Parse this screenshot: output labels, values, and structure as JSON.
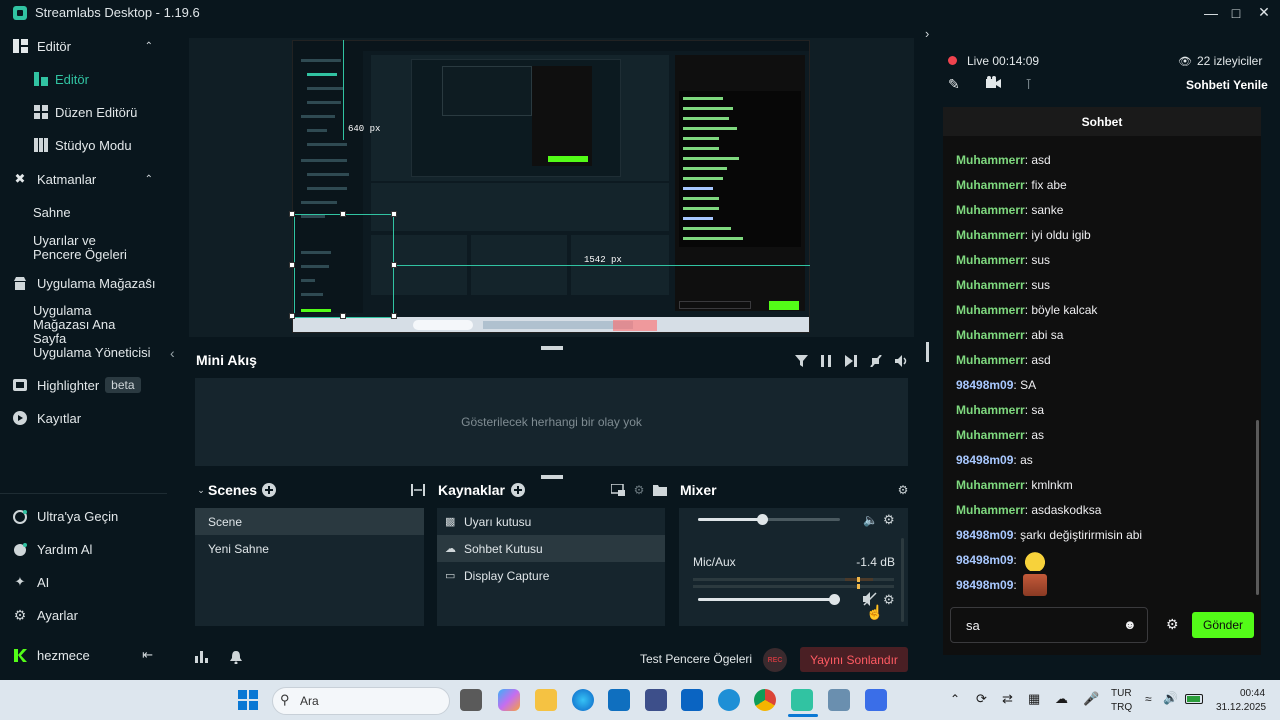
{
  "app": {
    "title": "Streamlabs Desktop - 1.19.6"
  },
  "sidebar": {
    "items": [
      {
        "label": "Editör",
        "icon": "layout-icon"
      },
      {
        "label": "Editör",
        "icon": "editor-icon"
      },
      {
        "label": "Düzen Editörü",
        "icon": "grid-icon"
      },
      {
        "label": "Stüdyo Modu",
        "icon": "studio-icon"
      },
      {
        "label": "Katmanlar",
        "icon": "tools-icon"
      },
      {
        "label": "Sahne"
      },
      {
        "label": "Uyarılar ve Pencere Ögeleri"
      },
      {
        "label": "Uygulama Mağazası",
        "icon": "store-icon"
      },
      {
        "label": "Uygulama Mağazası Ana Sayfa"
      },
      {
        "label": "Uygulama Yöneticisi"
      },
      {
        "label": "Highlighter",
        "icon": "highlighter-icon",
        "badge": "beta"
      },
      {
        "label": "Kayıtlar",
        "icon": "play-icon"
      }
    ],
    "bottom": [
      {
        "label": "Ultra'ya Geçin",
        "icon": "ultra-icon"
      },
      {
        "label": "Yardım Al",
        "icon": "help-icon"
      },
      {
        "label": "AI",
        "icon": "sparkle-icon"
      },
      {
        "label": "Ayarlar",
        "icon": "gear-icon"
      },
      {
        "label": "hezmece",
        "icon": "kick-icon"
      }
    ]
  },
  "preview": {
    "width_label": "640 px",
    "offset_label": "1542 px"
  },
  "minifeed": {
    "title": "Mini Akış",
    "empty": "Gösterilecek herhangi bir olay yok"
  },
  "scenes": {
    "title": "Scenes",
    "items": [
      "Scene",
      "Yeni Sahne"
    ]
  },
  "sources": {
    "title": "Kaynaklar",
    "items": [
      "Uyarı kutusu",
      "Sohbet Kutusu",
      "Display Capture"
    ]
  },
  "mixer": {
    "title": "Mixer",
    "channels": [
      {
        "name": "",
        "level": 0.45
      },
      {
        "name": "Mic/Aux",
        "db": "-1.4 dB",
        "level": 0.96
      }
    ]
  },
  "footer": {
    "test_label": "Test Pencere Ögeleri",
    "rec": "REC",
    "end_stream": "Yayını Sonlandır"
  },
  "live": {
    "status": "Live 00:14:09",
    "viewers": "22 izleyiciler",
    "refresh": "Sohbeti Yenile"
  },
  "chat": {
    "title": "Sohbet",
    "messages": [
      {
        "user": "Muhammerr",
        "text": "asd",
        "color": "#7fd97f"
      },
      {
        "user": "Muhammerr",
        "text": "fix abe",
        "color": "#7fd97f"
      },
      {
        "user": "Muhammerr",
        "text": "sanke",
        "color": "#7fd97f"
      },
      {
        "user": "Muhammerr",
        "text": "iyi oldu igib",
        "color": "#7fd97f"
      },
      {
        "user": "Muhammerr",
        "text": "sus",
        "color": "#7fd97f"
      },
      {
        "user": "Muhammerr",
        "text": "sus",
        "color": "#7fd97f"
      },
      {
        "user": "Muhammerr",
        "text": "böyle kalcak",
        "color": "#7fd97f"
      },
      {
        "user": "Muhammerr",
        "text": "abi sa",
        "color": "#7fd97f"
      },
      {
        "user": "Muhammerr",
        "text": "asd",
        "color": "#7fd97f"
      },
      {
        "user": "98498m09",
        "text": "SA",
        "color": "#a8c8ff"
      },
      {
        "user": "Muhammerr",
        "text": "sa",
        "color": "#7fd97f"
      },
      {
        "user": "Muhammerr",
        "text": "as",
        "color": "#7fd97f"
      },
      {
        "user": "98498m09",
        "text": "as",
        "color": "#a8c8ff"
      },
      {
        "user": "Muhammerr",
        "text": "kmlnkm",
        "color": "#7fd97f"
      },
      {
        "user": "Muhammerr",
        "text": "asdaskodksa",
        "color": "#7fd97f"
      },
      {
        "user": "98498m09",
        "text": "şarkı değiştirirmisin abi",
        "color": "#a8c8ff"
      },
      {
        "user": "98498m09",
        "text": "",
        "color": "#a8c8ff",
        "emote": "smile-emote"
      },
      {
        "user": "98498m09",
        "text": "",
        "color": "#a8c8ff",
        "emote": "face-emote"
      }
    ],
    "input_value": "sa",
    "send": "Gönder"
  },
  "taskbar": {
    "search_placeholder": "Ara",
    "lang_top": "TUR",
    "lang_bottom": "TRQ",
    "time": "00:44",
    "date": "31.12.2025"
  }
}
